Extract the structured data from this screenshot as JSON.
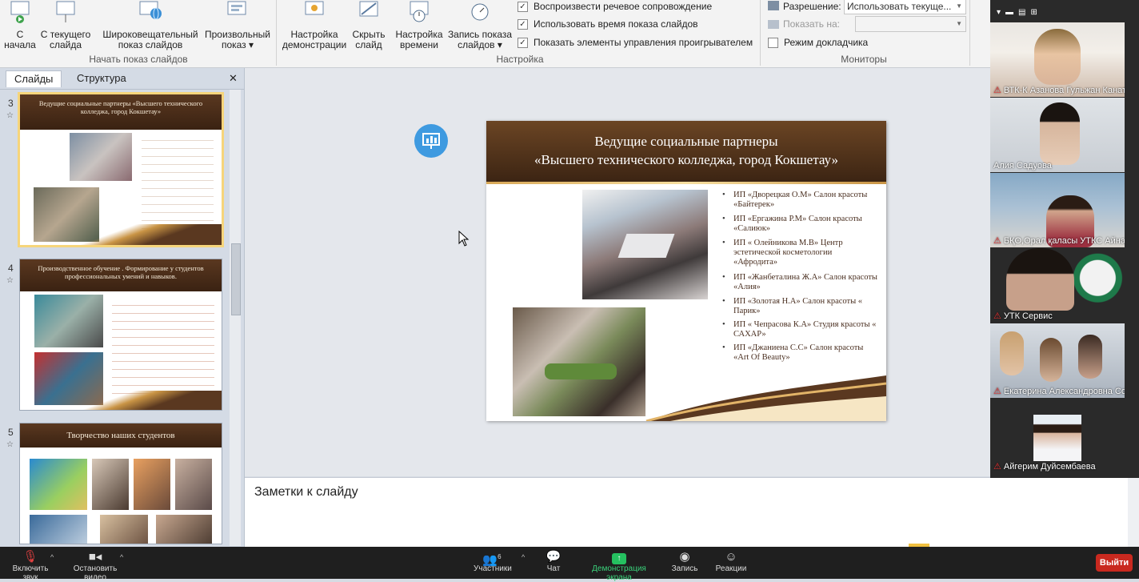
{
  "ribbon": {
    "groups": [
      {
        "label": "Начать показ слайдов"
      },
      {
        "label": "Настройка"
      },
      {
        "label": "Мониторы"
      }
    ],
    "start_buttons": [
      {
        "line1": "С",
        "line2": "начала"
      },
      {
        "line1": "С текущего",
        "line2": "слайда"
      },
      {
        "line1": "Широковещательный",
        "line2": "показ слайдов"
      },
      {
        "line1": "Произвольный",
        "line2": "показ ▾"
      }
    ],
    "setup_buttons": [
      {
        "line1": "Настройка",
        "line2": "демонстрации"
      },
      {
        "line1": "Скрыть",
        "line2": "слайд"
      },
      {
        "line1": "Настройка",
        "line2": "времени"
      },
      {
        "line1": "Запись показа",
        "line2": "слайдов ▾"
      }
    ],
    "checkboxes": [
      {
        "label": "Воспроизвести речевое сопровождение",
        "checked": "✓"
      },
      {
        "label": "Использовать время показа слайдов",
        "checked": "✓"
      },
      {
        "label": "Показать элементы управления проигрывателем",
        "checked": "✓"
      }
    ],
    "monitors": {
      "resolution_label": "Разрешение:",
      "resolution_value": "Использовать текуще...",
      "show_on_label": "Показать на:",
      "presenter_label": "Режим докладчика"
    }
  },
  "panel": {
    "tabs": [
      "Слайды",
      "Структура"
    ],
    "close": "✕",
    "slides": [
      {
        "num": "3",
        "title": "Ведущие социальные партнеры «Высшего технического колледжа, город Кокшетау»"
      },
      {
        "num": "4",
        "title": "Производственное обучение . Формирование у студентов профессиональных умений и навыков."
      },
      {
        "num": "5",
        "title": "Творчество наших студентов"
      }
    ]
  },
  "slide": {
    "title_line1": "Ведущие социальные партнеры",
    "title_line2": "«Высшего технического колледжа, город Кокшетау»",
    "bullets": [
      "ИП «Дворецкая О.М» Салон красоты «Байтерек»",
      "ИП «Ергажина Р.М» Салон красоты «Салиюк»",
      "ИП « Олейникова М.В» Центр эстетической косметологии «Афродита»",
      "ИП «Жанбеталина Ж.А» Салон красоты «Алия»",
      "ИП «Золотая Н.А» Салон красоты « Парик»",
      "ИП « Чепрасова К.А» Студия красоты « САХАР»",
      "ИП «Джаниена С.С» Салон красоты «Art Of Beauty»"
    ]
  },
  "notes": {
    "label": "Заметки к слайду"
  },
  "participants": [
    {
      "name": "ВТК-К Азанова Гульжан Канато..."
    },
    {
      "name": "Алия Садуова"
    },
    {
      "name": "БҚО,Орал қаласы УТКС Айнагу..."
    },
    {
      "name": "УТК Сервис"
    },
    {
      "name": "Екатерина Александровна Сол..."
    },
    {
      "name": "Айгерим Дуйсембаева"
    }
  ],
  "toolbar": {
    "mute": "Включить звук",
    "video": "Остановить видео",
    "participants": "Участники",
    "participants_count": "6",
    "chat": "Чат",
    "share": "Демонстрация экрана",
    "record": "Запись",
    "reactions": "Реакции",
    "exit": "Выйти"
  },
  "colors": {
    "share_green": "#25c060",
    "exit_red": "#c9291f",
    "slide_brown": "#4a2b16"
  }
}
